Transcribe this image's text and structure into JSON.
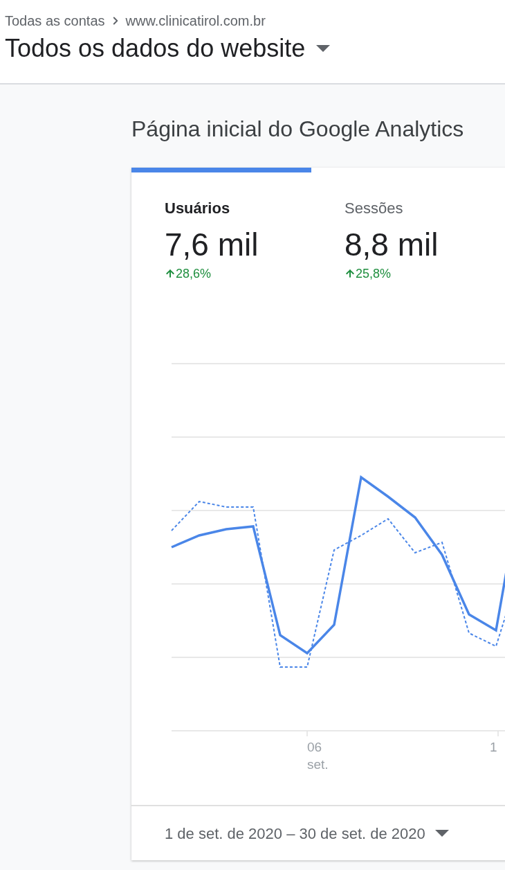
{
  "breadcrumb": [
    {
      "label": "Todas as contas"
    },
    {
      "label": "www.clinicatirol.com.br"
    }
  ],
  "view": {
    "title": "Todos os dados do website"
  },
  "page_title": "Página inicial do Google Analytics",
  "metrics": [
    {
      "label": "Usuários",
      "value": "7,6 mil",
      "change": "28,6%",
      "selected": true
    },
    {
      "label": "Sessões",
      "value": "8,8 mil",
      "change": "25,8%",
      "selected": false
    }
  ],
  "chart": {
    "x_labels": [
      {
        "day": "06",
        "month": "set."
      },
      {
        "day": "1"
      }
    ]
  },
  "date_range": "1 de set. de 2020 – 30 de set. de 2020"
}
